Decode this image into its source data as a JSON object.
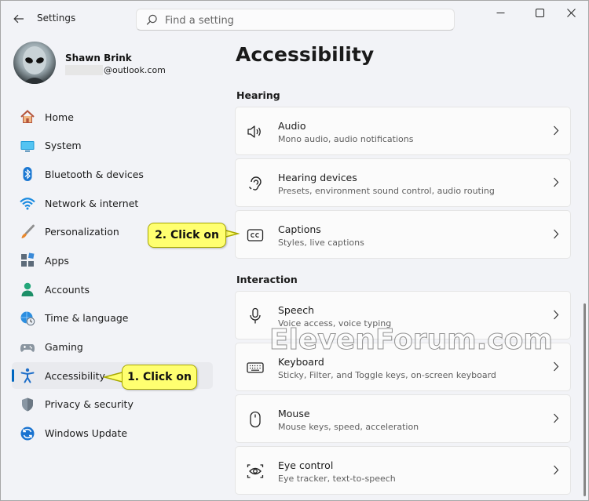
{
  "window": {
    "title": "Settings",
    "controls": {
      "minimize": "minimize-icon",
      "maximize": "maximize-icon",
      "close": "close-icon"
    }
  },
  "search": {
    "placeholder": "Find a setting"
  },
  "profile": {
    "name": "Shawn Brink",
    "email_suffix": "@outlook.com"
  },
  "sidebar": {
    "items": [
      {
        "label": "Home",
        "icon": "home-icon"
      },
      {
        "label": "System",
        "icon": "system-icon"
      },
      {
        "label": "Bluetooth & devices",
        "icon": "bluetooth-icon"
      },
      {
        "label": "Network & internet",
        "icon": "wifi-icon"
      },
      {
        "label": "Personalization",
        "icon": "brush-icon"
      },
      {
        "label": "Apps",
        "icon": "apps-icon"
      },
      {
        "label": "Accounts",
        "icon": "accounts-icon"
      },
      {
        "label": "Time & language",
        "icon": "globe-clock-icon"
      },
      {
        "label": "Gaming",
        "icon": "gamepad-icon"
      },
      {
        "label": "Accessibility",
        "icon": "accessibility-icon",
        "selected": true
      },
      {
        "label": "Privacy & security",
        "icon": "shield-icon"
      },
      {
        "label": "Windows Update",
        "icon": "update-icon"
      }
    ]
  },
  "main": {
    "title": "Accessibility",
    "sections": [
      {
        "label": "Hearing",
        "cards": [
          {
            "title": "Audio",
            "subtitle": "Mono audio, audio notifications",
            "icon": "speaker-icon"
          },
          {
            "title": "Hearing devices",
            "subtitle": "Presets, environment sound control, audio routing",
            "icon": "ear-icon"
          },
          {
            "title": "Captions",
            "subtitle": "Styles, live captions",
            "icon": "closed-captions-icon"
          }
        ]
      },
      {
        "label": "Interaction",
        "cards": [
          {
            "title": "Speech",
            "subtitle": "Voice access, voice typing",
            "icon": "microphone-icon"
          },
          {
            "title": "Keyboard",
            "subtitle": "Sticky, Filter, and Toggle keys, on-screen keyboard",
            "icon": "keyboard-icon"
          },
          {
            "title": "Mouse",
            "subtitle": "Mouse keys, speed, acceleration",
            "icon": "mouse-icon"
          },
          {
            "title": "Eye control",
            "subtitle": "Eye tracker, text-to-speech",
            "icon": "eye-control-icon"
          }
        ]
      }
    ]
  },
  "annotations": {
    "step1": "1. Click on",
    "step2": "2. Click on"
  },
  "watermark": "ElevenForum.com",
  "colors": {
    "accent": "#0067c0",
    "callout": "#ffff70"
  }
}
